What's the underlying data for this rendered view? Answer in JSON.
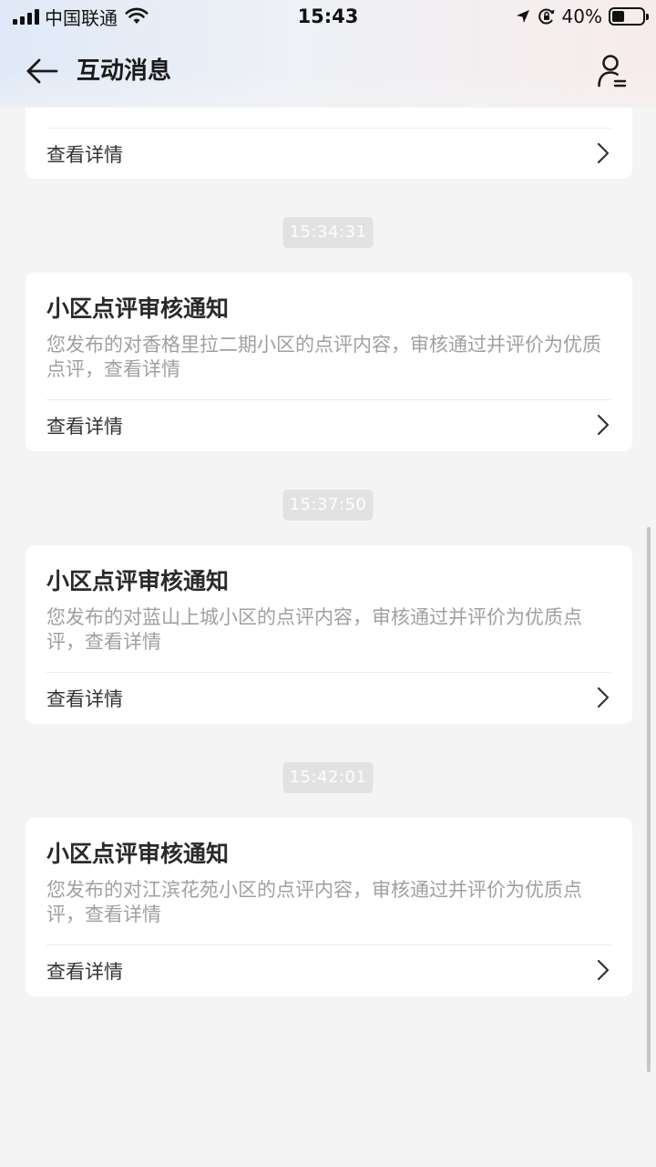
{
  "status_bar": {
    "carrier": "中国联通",
    "time": "15:43",
    "battery_percent": "40%",
    "battery_level": 0.4
  },
  "nav": {
    "title": "互动消息"
  },
  "partial_card": {
    "detail_label": "查看详情"
  },
  "messages": [
    {
      "time": "15:34:31",
      "title": "小区点评审核通知",
      "desc": "您发布的对香格里拉二期小区的点评内容，审核通过并评价为优质点评，查看详情",
      "detail_label": "查看详情"
    },
    {
      "time": "15:37:50",
      "title": "小区点评审核通知",
      "desc": "您发布的对蓝山上城小区的点评内容，审核通过并评价为优质点评，查看详情",
      "detail_label": "查看详情"
    },
    {
      "time": "15:42:01",
      "title": "小区点评审核通知",
      "desc": "您发布的对江滨花苑小区的点评内容，审核通过并评价为优质点评，查看详情",
      "detail_label": "查看详情"
    }
  ]
}
